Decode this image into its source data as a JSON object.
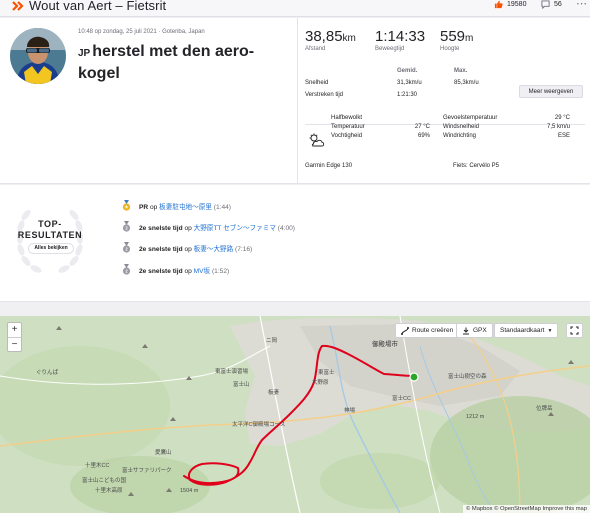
{
  "header": {
    "title": "Wout van Aert – Fietsrit",
    "kudos_count": "19580",
    "comment_count": "56"
  },
  "activity": {
    "meta": "10:48 op zondag, 25 juli 2021 · Gotenba, Japan",
    "flag": "JP",
    "title": "herstel met den aero-kogel"
  },
  "stats": {
    "distance": {
      "value": "38,85",
      "unit": "km",
      "label": "Afstand"
    },
    "moving_time": {
      "value": "1:14:33",
      "unit": "",
      "label": "Beweegtijd"
    },
    "elevation": {
      "value": "559",
      "unit": "m",
      "label": "Hoogte"
    }
  },
  "table": {
    "col_avg": "Gemid.",
    "col_max": "Max.",
    "rows": [
      {
        "label": "Snelheid",
        "avg": "31,3km/u",
        "max": "85,3km/u"
      },
      {
        "label": "Verstreken tijd",
        "avg": "1:21:30",
        "max": ""
      }
    ],
    "more_button": "Meer weergeven"
  },
  "weather": {
    "condition": "Halfbewolkt",
    "temperature_label": "Temperatuur",
    "temperature": "27 °C",
    "humidity_label": "Vochtigheid",
    "humidity": "69%",
    "feels_like_label": "Gevoelstemperatuur",
    "feels_like": "29 °C",
    "wind_speed_label": "Windsnelheid",
    "wind_speed": "7,5 km/u",
    "wind_dir_label": "Windrichting",
    "wind_dir": "ESE"
  },
  "gear": {
    "device": "Garmin Edge 130",
    "bike": "Fiets: Cervélo P5"
  },
  "top_results": {
    "badge_line1": "TOP-",
    "badge_line2": "RESULTATEN",
    "view_all": "Alles bekijken",
    "items": [
      {
        "rank": "PR",
        "mid": " op ",
        "segment": "板妻駐屯地～原里",
        "time": "(1:44)",
        "medal": "gold"
      },
      {
        "rank": "2e snelste tijd",
        "mid": " op ",
        "segment": "大野原TT セブン～ファミマ",
        "time": "(4:00)",
        "medal": "silver"
      },
      {
        "rank": "2e snelste tijd",
        "mid": " op ",
        "segment": "板妻～大野路",
        "time": "(7:16)",
        "medal": "silver"
      },
      {
        "rank": "2e snelste tijd",
        "mid": " op ",
        "segment": "MV坂",
        "time": "(1:52)",
        "medal": "silver"
      }
    ]
  },
  "map": {
    "zoom_in": "+",
    "zoom_out": "−",
    "route_button": "Route creëren",
    "gpx_button": "GPX",
    "map_type": "Standaardkaart",
    "attribution": "© Mapbox © OpenStreetMap Improve this map",
    "labels": [
      "御殿場市",
      "富士山",
      "富士CC",
      "十里木CC",
      "富士山こどもの国",
      "富士サファリパーク",
      "大野原",
      "東富士演習場",
      "板妻",
      "愛鷹山",
      "十里木高原",
      "ぐりんぱ",
      "太平洋C御殿場コース",
      "ニ岡",
      "神場",
      "東富士",
      "1212 m",
      "1504 m",
      "位牌岳",
      "富士山樹空の森"
    ]
  },
  "colors": {
    "brand": "#fc5200",
    "link": "#1f6fd2",
    "route": "#e0001b"
  }
}
